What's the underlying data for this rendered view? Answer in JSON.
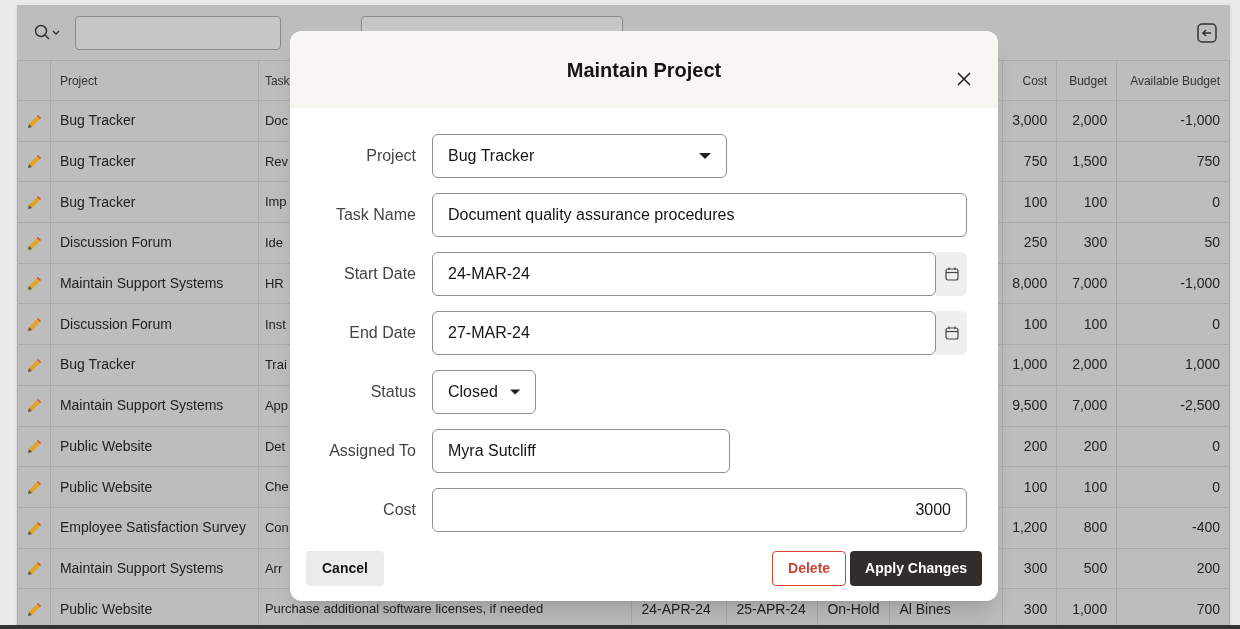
{
  "table": {
    "columns": [
      "",
      "Project",
      "Task",
      "",
      "",
      "",
      "",
      "Cost",
      "Budget",
      "Available Budget"
    ],
    "rows": [
      {
        "project": "Bug Tracker",
        "task": "Doc",
        "cost": "3,000",
        "budget": "2,000",
        "available": "-1,000"
      },
      {
        "project": "Bug Tracker",
        "task": "Rev",
        "cost": "750",
        "budget": "1,500",
        "available": "750"
      },
      {
        "project": "Bug Tracker",
        "task": "Imp",
        "cost": "100",
        "budget": "100",
        "available": "0"
      },
      {
        "project": "Discussion Forum",
        "task": "Ide",
        "cost": "250",
        "budget": "300",
        "available": "50"
      },
      {
        "project": "Maintain Support Systems",
        "task": "HR",
        "cost": "8,000",
        "budget": "7,000",
        "available": "-1,000"
      },
      {
        "project": "Discussion Forum",
        "task": "Inst",
        "cost": "100",
        "budget": "100",
        "available": "0"
      },
      {
        "project": "Bug Tracker",
        "task": "Trai",
        "cost": "1,000",
        "budget": "2,000",
        "available": "1,000"
      },
      {
        "project": "Maintain Support Systems",
        "task": "App",
        "cost": "9,500",
        "budget": "7,000",
        "available": "-2,500"
      },
      {
        "project": "Public Website",
        "task": "Det",
        "cost": "200",
        "budget": "200",
        "available": "0"
      },
      {
        "project": "Public Website",
        "task": "Che",
        "cost": "100",
        "budget": "100",
        "available": "0"
      },
      {
        "project": "Employee Satisfaction Survey",
        "task": "Con",
        "cost": "1,200",
        "budget": "800",
        "available": "-400"
      },
      {
        "project": "Maintain Support Systems",
        "task": "Arr",
        "cost": "300",
        "budget": "500",
        "available": "200"
      },
      {
        "project": "Public Website",
        "task": "Purchase additional software licenses, if needed",
        "start": "24-APR-24",
        "end": "25-APR-24",
        "status": "On-Hold",
        "assigned": "Al Bines",
        "cost": "300",
        "budget": "1,000",
        "available": "700"
      }
    ]
  },
  "dialog": {
    "title": "Maintain Project",
    "fields": [
      {
        "label": "Project",
        "kind": "select",
        "value": "Bug Tracker"
      },
      {
        "label": "Task Name",
        "kind": "text",
        "value": "Document quality assurance procedures"
      },
      {
        "label": "Start Date",
        "kind": "date",
        "value": "24-MAR-24"
      },
      {
        "label": "End Date",
        "kind": "date",
        "value": "27-MAR-24"
      },
      {
        "label": "Status",
        "kind": "select",
        "value": "Closed"
      },
      {
        "label": "Assigned To",
        "kind": "text",
        "value": "Myra Sutcliff"
      },
      {
        "label": "Cost",
        "kind": "number",
        "value": "3000"
      }
    ],
    "buttons": [
      {
        "label": "Cancel",
        "kind": "secondary"
      },
      {
        "label": "Delete",
        "kind": "danger"
      },
      {
        "label": "Apply Changes",
        "kind": "primary"
      }
    ]
  }
}
